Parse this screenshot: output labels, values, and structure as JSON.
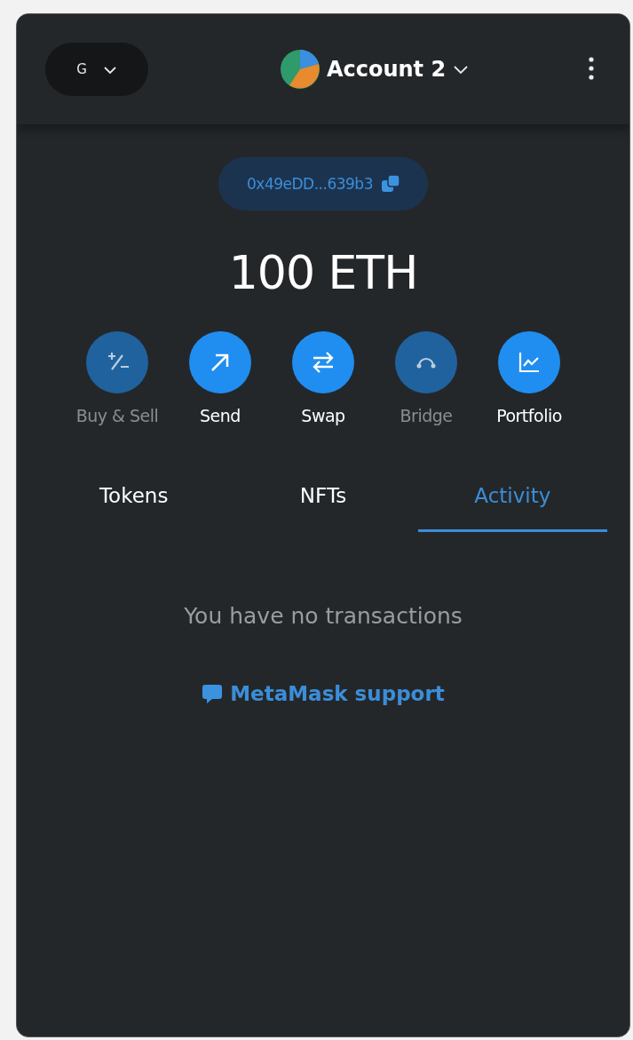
{
  "header": {
    "network": {
      "label": "G"
    },
    "account": {
      "name": "Account 2"
    }
  },
  "address": "0x49eDD...639b3",
  "balance": "100 ETH",
  "actions": [
    {
      "kind": "buysell",
      "label": "Buy & Sell",
      "disabled": true
    },
    {
      "kind": "send",
      "label": "Send",
      "disabled": false
    },
    {
      "kind": "swap",
      "label": "Swap",
      "disabled": false
    },
    {
      "kind": "bridge",
      "label": "Bridge",
      "disabled": true
    },
    {
      "kind": "portfolio",
      "label": "Portfolio",
      "disabled": false
    }
  ],
  "tabs": [
    {
      "label": "Tokens",
      "selected": false
    },
    {
      "label": "NFTs",
      "selected": false
    },
    {
      "label": "Activity",
      "selected": true
    }
  ],
  "empty_message": "You have no transactions",
  "support_link": "MetaMask support"
}
